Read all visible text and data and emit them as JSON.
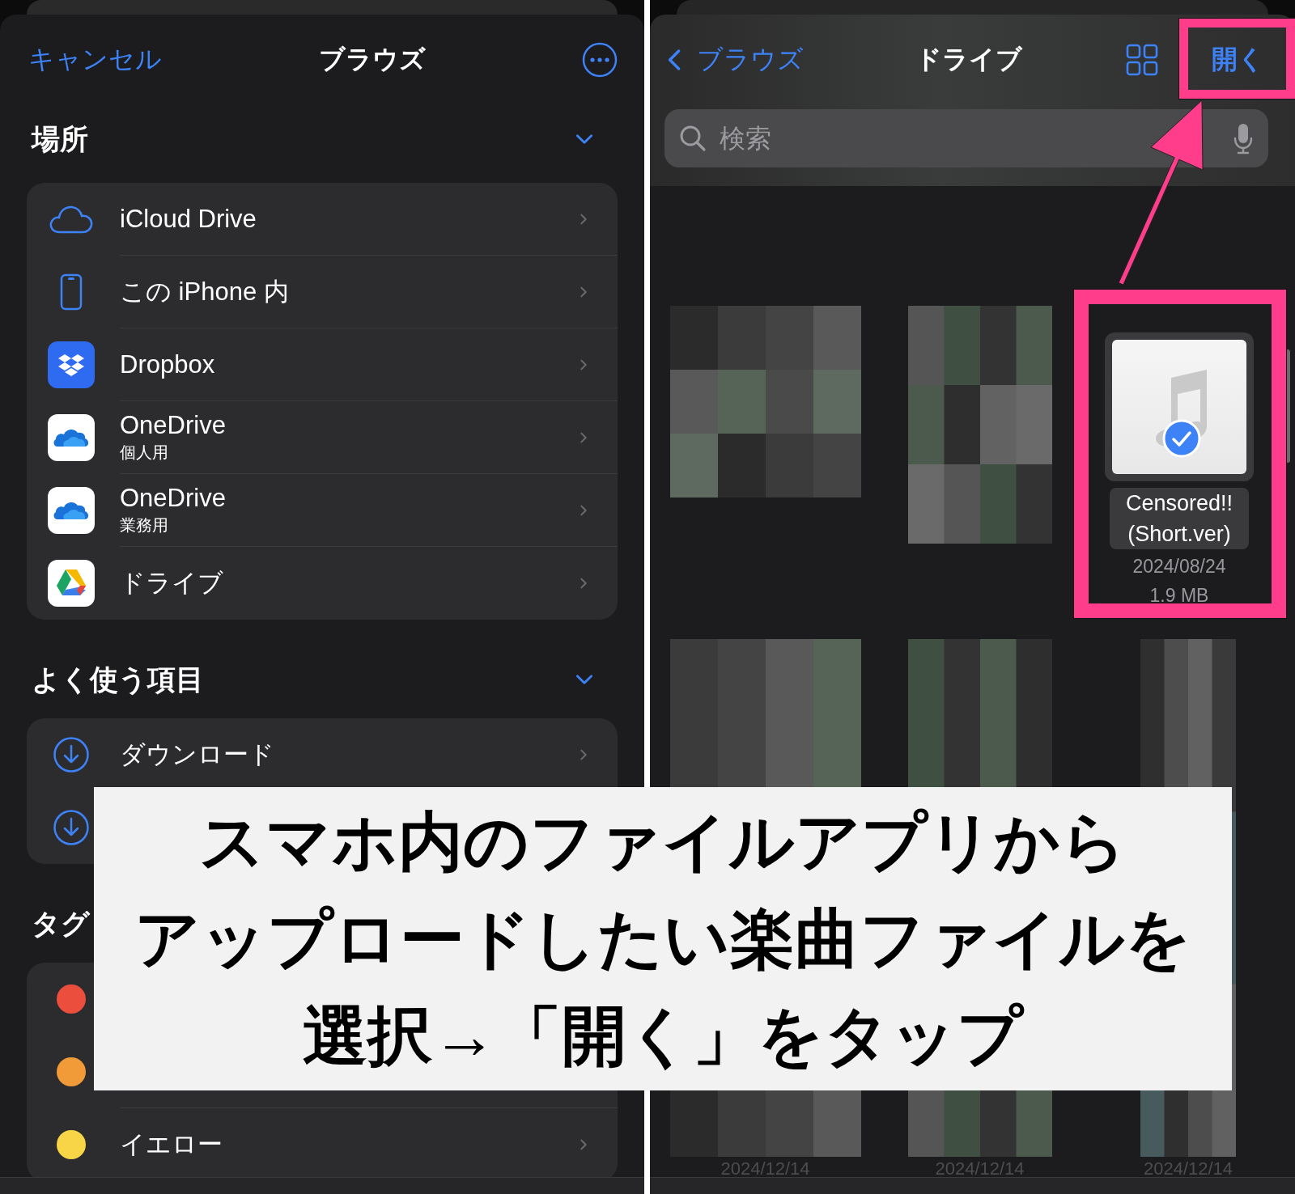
{
  "left": {
    "header": {
      "cancel": "キャンセル",
      "title": "ブラウズ"
    },
    "sections": [
      {
        "title": "場所",
        "expanded": true,
        "rows": [
          {
            "kind": "icloud",
            "label": "iCloud Drive"
          },
          {
            "kind": "iphone",
            "label": "この iPhone 内"
          },
          {
            "kind": "dropbox",
            "label": "Dropbox"
          },
          {
            "kind": "onedrive",
            "label": "OneDrive",
            "subtitle": "個人用"
          },
          {
            "kind": "onedrive",
            "label": "OneDrive",
            "subtitle": "業務用"
          },
          {
            "kind": "gdrive",
            "label": "ドライブ"
          }
        ]
      },
      {
        "title": "よく使う項目",
        "expanded": true,
        "rows": [
          {
            "kind": "download",
            "label": "ダウンロード"
          },
          {
            "kind": "download"
          }
        ]
      },
      {
        "title": "タグ",
        "rows": [
          {
            "kind": "tag",
            "color": "#eb4e3d"
          },
          {
            "kind": "tag",
            "color": "#f19a38"
          },
          {
            "kind": "tag",
            "label": "イエロー",
            "color": "#f7d547"
          }
        ]
      }
    ]
  },
  "right": {
    "header": {
      "back": "ブラウズ",
      "title": "ドライブ",
      "open": "開く"
    },
    "search": {
      "placeholder": "検索"
    },
    "items": [
      {
        "kind": "picture"
      },
      {
        "kind": "picture"
      },
      {
        "kind": "file",
        "name": "Censored!! (Short.ver)",
        "date": "2024/08/24",
        "size": "1.9 MB",
        "selected": true
      },
      {
        "kind": "picture"
      },
      {
        "kind": "picture"
      },
      {
        "kind": "picture"
      }
    ],
    "bottom_dates": [
      "2024/12/14",
      "2024/12/14",
      "2024/12/14"
    ]
  },
  "caption": {
    "lines": [
      "スマホ内のファイルアプリから",
      "アップロードしたい楽曲ファイルを",
      "選択→「開く」をタップ"
    ]
  }
}
